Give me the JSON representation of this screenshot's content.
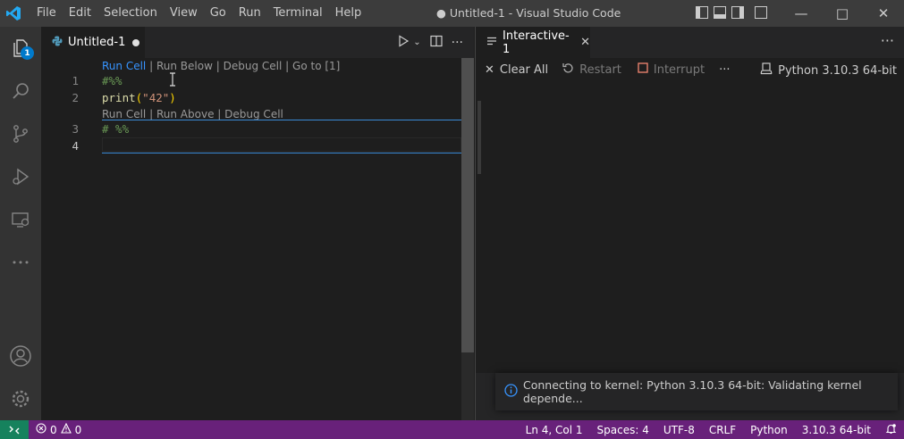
{
  "window": {
    "title": "● Untitled-1 - Visual Studio Code",
    "menu": [
      "File",
      "Edit",
      "Selection",
      "View",
      "Go",
      "Run",
      "Terminal",
      "Help"
    ]
  },
  "activity": {
    "explorer_badge": "1"
  },
  "editor": {
    "tab_label": "Untitled-1",
    "codelens1": {
      "run_cell": "Run Cell",
      "run_below": "Run Below",
      "debug_cell": "Debug Cell",
      "goto": "Go to [1]",
      "sep": "|"
    },
    "codelens2": {
      "run_cell": "Run Cell",
      "run_above": "Run Above",
      "debug_cell": "Debug Cell",
      "sep": "|"
    },
    "lines": [
      {
        "num": "1",
        "text": "#%%"
      },
      {
        "num": "2",
        "fn": "print",
        "open": "(",
        "str": "\"42\"",
        "close": ")"
      },
      {
        "num": "3",
        "text": "# %%"
      },
      {
        "num": "4",
        "text": ""
      }
    ]
  },
  "interactive": {
    "tab_label": "Interactive-1",
    "clear_all": "Clear All",
    "restart": "Restart",
    "interrupt": "Interrupt",
    "kernel": "Python 3.10.3 64-bit"
  },
  "notification": {
    "text": "Connecting to kernel: Python 3.10.3 64-bit: Validating kernel depende..."
  },
  "status": {
    "errors": "0",
    "warnings": "0",
    "position": "Ln 4, Col 1",
    "spaces": "Spaces: 4",
    "encoding": "UTF-8",
    "eol": "CRLF",
    "language": "Python",
    "interpreter": "3.10.3 64-bit"
  },
  "colors": {
    "accent": "#007acc",
    "statusbar": "#68217a",
    "remote": "#16825d"
  }
}
